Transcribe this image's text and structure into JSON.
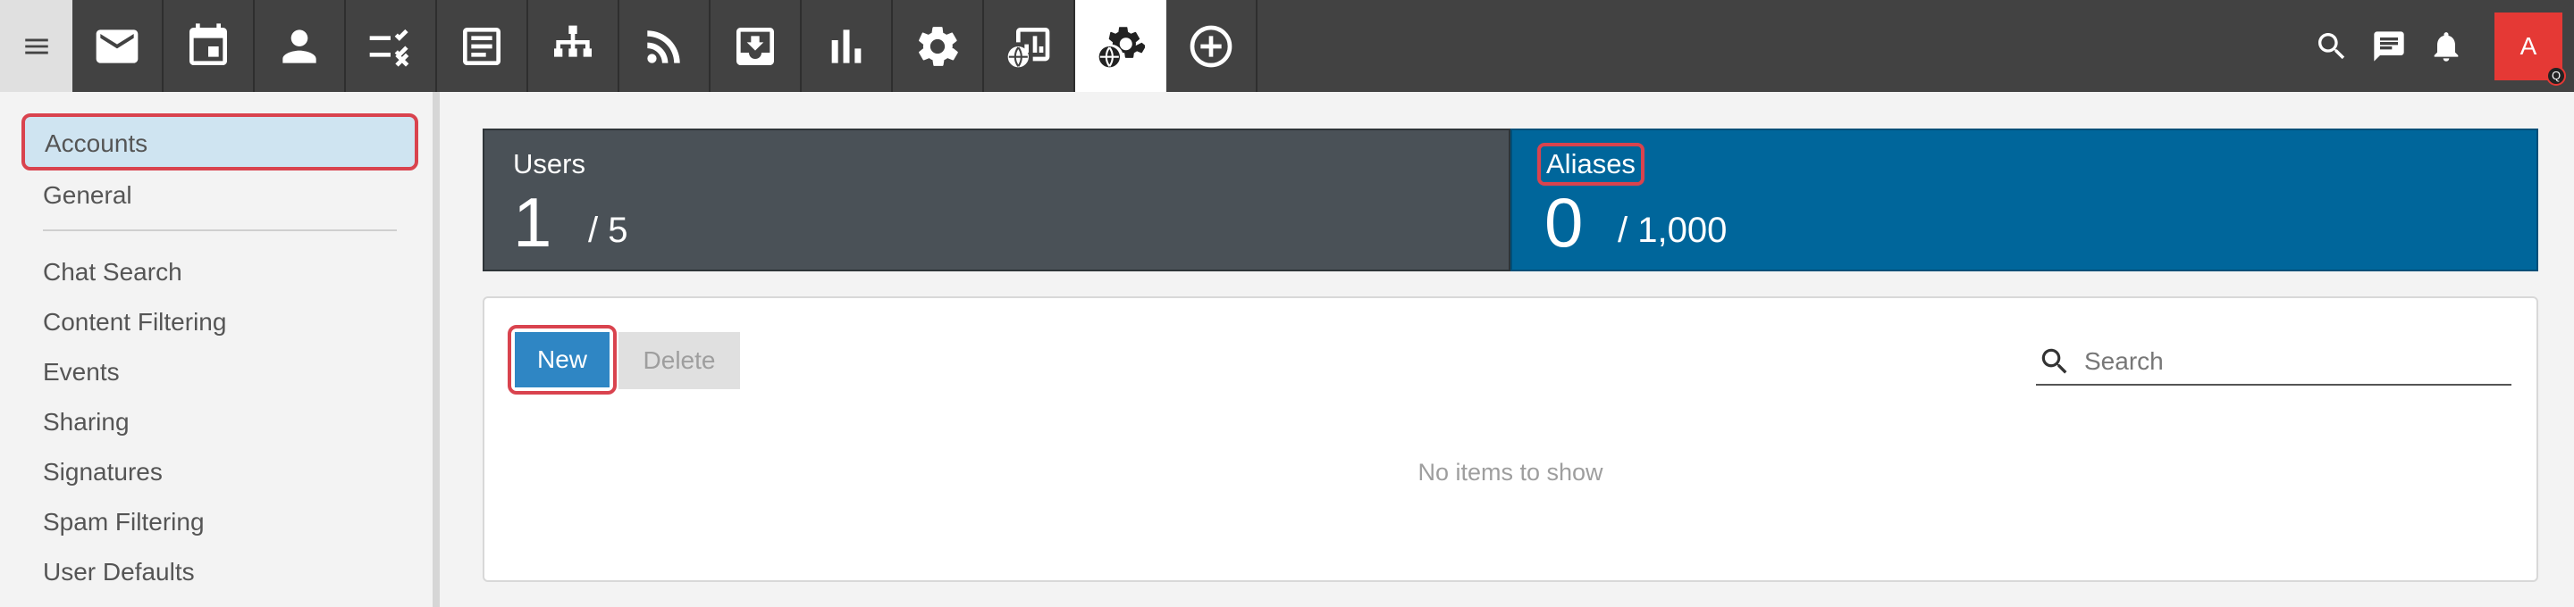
{
  "topbar": {
    "apps": [
      {
        "icon": "mail-icon",
        "active": false
      },
      {
        "icon": "calendar-icon",
        "active": false
      },
      {
        "icon": "contacts-icon",
        "active": false
      },
      {
        "icon": "tasks-icon",
        "active": false
      },
      {
        "icon": "notes-icon",
        "active": false
      },
      {
        "icon": "org-chart-icon",
        "active": false
      },
      {
        "icon": "rss-icon",
        "active": false
      },
      {
        "icon": "inbox-download-icon",
        "active": false
      },
      {
        "icon": "reports-icon",
        "active": false
      },
      {
        "icon": "settings-icon",
        "active": false
      },
      {
        "icon": "domain-reports-icon",
        "active": false
      },
      {
        "icon": "domain-settings-icon",
        "active": true
      },
      {
        "icon": "add-circle-icon",
        "active": false
      }
    ],
    "avatar_letter": "A",
    "avatar_badge": "Q",
    "colors": {
      "bar": "#424242",
      "avatar": "#e53935"
    }
  },
  "sidebar": {
    "items": [
      {
        "label": "Accounts",
        "selected": true
      },
      {
        "label": "General"
      },
      {
        "label": "Chat Search"
      },
      {
        "label": "Content Filtering"
      },
      {
        "label": "Events"
      },
      {
        "label": "Sharing"
      },
      {
        "label": "Signatures"
      },
      {
        "label": "Spam Filtering"
      },
      {
        "label": "User Defaults"
      }
    ]
  },
  "stats": {
    "users": {
      "label": "Users",
      "count": "1",
      "total": "/ 5"
    },
    "aliases": {
      "label": "Aliases",
      "count": "0",
      "total": "/ 1,000"
    }
  },
  "toolbar": {
    "new_label": "New",
    "delete_label": "Delete",
    "search_placeholder": "Search"
  },
  "list": {
    "empty_message": "No items to show"
  }
}
